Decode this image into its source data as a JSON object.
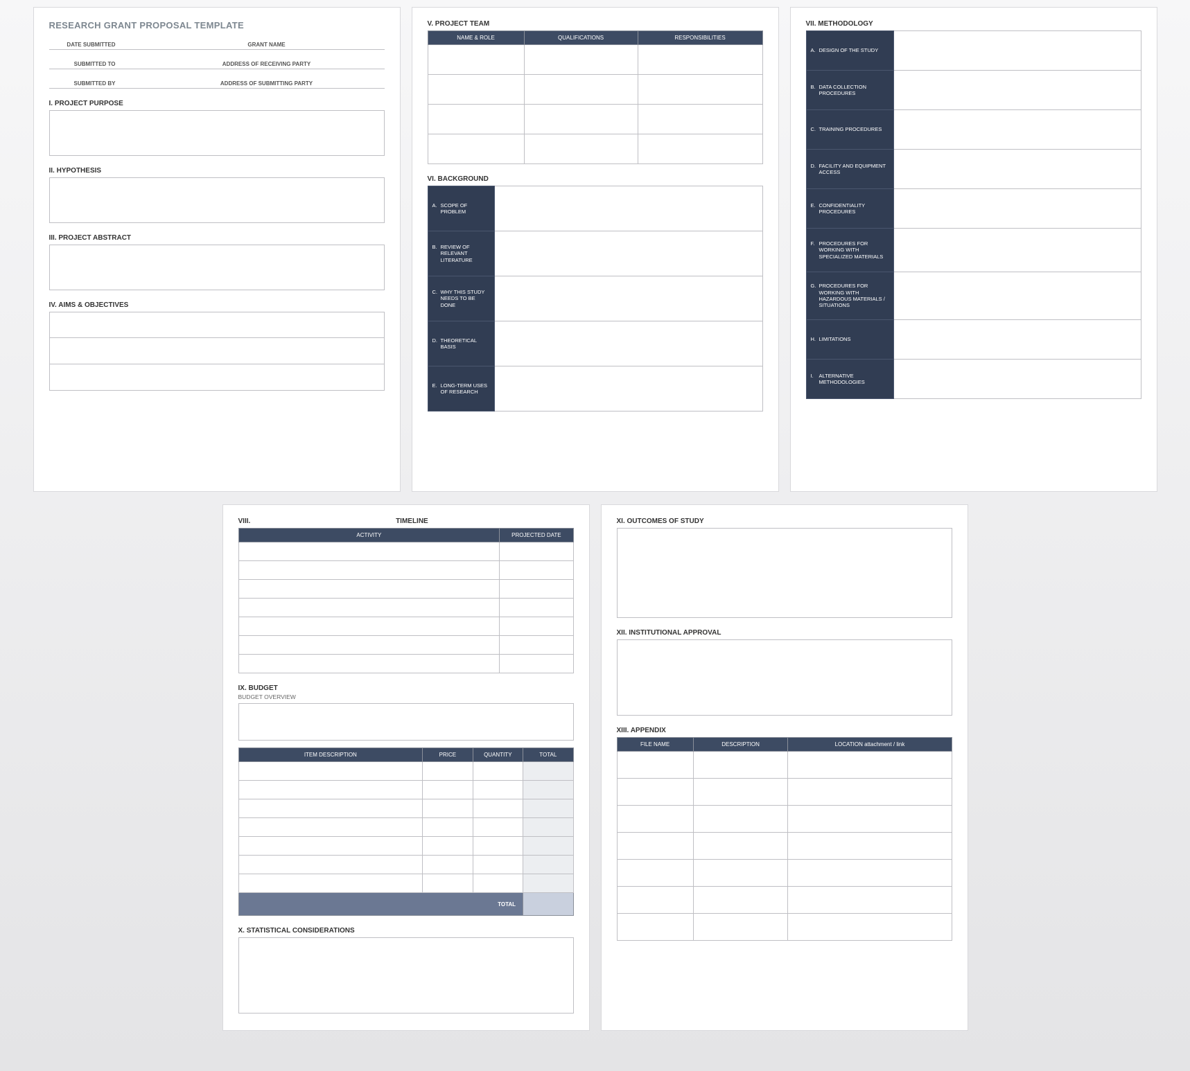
{
  "title": "RESEARCH GRANT PROPOSAL TEMPLATE",
  "meta": {
    "date_submitted": "DATE SUBMITTED",
    "grant_name": "GRANT NAME",
    "submitted_to": "SUBMITTED TO",
    "address_receiving": "ADDRESS OF RECEIVING PARTY",
    "submitted_by": "SUBMITTED BY",
    "address_submitting": "ADDRESS OF SUBMITTING PARTY"
  },
  "sections": {
    "i": "I.   PROJECT PURPOSE",
    "ii": "II.  HYPOTHESIS",
    "iii": "III. PROJECT ABSTRACT",
    "iv": "IV. AIMS & OBJECTIVES",
    "v": "V.  PROJECT TEAM",
    "vi": "VI. BACKGROUND",
    "vii": "VII. METHODOLOGY",
    "viii": "VIII.",
    "viii_t": "TIMELINE",
    "ix": "IX. BUDGET",
    "ix_sub": "BUDGET OVERVIEW",
    "x": "X.   STATISTICAL CONSIDERATIONS",
    "xi": "XI.  OUTCOMES OF STUDY",
    "xii": "XII. INSTITUTIONAL APPROVAL",
    "xiii": "XIII. APPENDIX"
  },
  "team_headers": {
    "name": "NAME & ROLE",
    "qual": "QUALIFICATIONS",
    "resp": "RESPONSIBILITIES"
  },
  "background": [
    {
      "l": "A.",
      "t": "SCOPE OF PROBLEM"
    },
    {
      "l": "B.",
      "t": "REVIEW OF RELEVANT LITERATURE"
    },
    {
      "l": "C.",
      "t": "WHY THIS STUDY NEEDS TO BE DONE"
    },
    {
      "l": "D.",
      "t": "THEORETICAL BASIS"
    },
    {
      "l": "E.",
      "t": "LONG-TERM USES OF RESEARCH"
    }
  ],
  "methodology": [
    {
      "l": "A.",
      "t": "DESIGN OF THE STUDY"
    },
    {
      "l": "B.",
      "t": "DATA COLLECTION PROCEDURES"
    },
    {
      "l": "C.",
      "t": "TRAINING PROCEDURES"
    },
    {
      "l": "D.",
      "t": "FACILITY AND EQUIPMENT ACCESS"
    },
    {
      "l": "E.",
      "t": "CONFIDENTIALITY PROCEDURES"
    },
    {
      "l": "F.",
      "t": "PROCEDURES FOR WORKING WITH SPECIALIZED MATERIALS"
    },
    {
      "l": "G.",
      "t": "PROCEDURES FOR WORKING WITH HAZARDOUS MATERIALS / SITUATIONS"
    },
    {
      "l": "H.",
      "t": "LIMITATIONS"
    },
    {
      "l": "I.",
      "t": "ALTERNATIVE METHODOLOGIES"
    }
  ],
  "timeline_headers": {
    "activity": "ACTIVITY",
    "date": "PROJECTED DATE"
  },
  "budget_headers": {
    "item": "ITEM DESCRIPTION",
    "price": "PRICE",
    "qty": "QUANTITY",
    "total": "TOTAL"
  },
  "budget_total": "TOTAL",
  "appendix_headers": {
    "file": "FILE NAME",
    "desc": "DESCRIPTION",
    "loc": "LOCATION attachment / link"
  }
}
